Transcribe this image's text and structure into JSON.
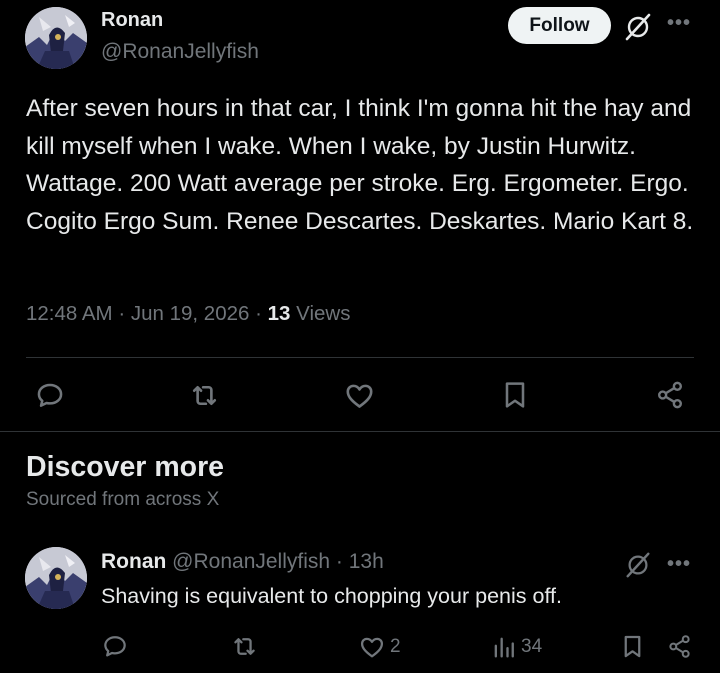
{
  "tweet": {
    "author_name": "Ronan",
    "author_handle": "@RonanJellyfish",
    "follow_label": "Follow",
    "text": "After seven hours in that car, I think I'm gonna hit the hay and kill myself when I wake. When I wake, by Justin Hurwitz. Wattage. 200 Watt average per stroke. Erg. Ergometer. Ergo. Cogito Ergo Sum. Renee Descartes. Deskartes. Mario Kart 8.",
    "time": "12:48 AM",
    "date": "Jun 19, 2026",
    "views_count": "13",
    "views_label": "Views",
    "separator": "·"
  },
  "icons": {
    "grok": "grok-icon",
    "more": "more-icon",
    "actions": [
      "reply-icon",
      "retweet-icon",
      "like-icon",
      "bookmark-icon",
      "share-icon"
    ]
  },
  "discover": {
    "title": "Discover more",
    "subtitle": "Sourced from across X"
  },
  "reply": {
    "author_name": "Ronan",
    "author_handle": "@RonanJellyfish",
    "separator": "·",
    "time_ago": "13h",
    "text": "Shaving is equivalent to chopping your penis off.",
    "like_count": "2",
    "view_count": "34"
  },
  "colors": {
    "background": "#000000",
    "text_primary": "#e7e9ea",
    "text_secondary": "#71767b",
    "divider": "#2f3336",
    "follow_bg": "#eff3f4"
  }
}
